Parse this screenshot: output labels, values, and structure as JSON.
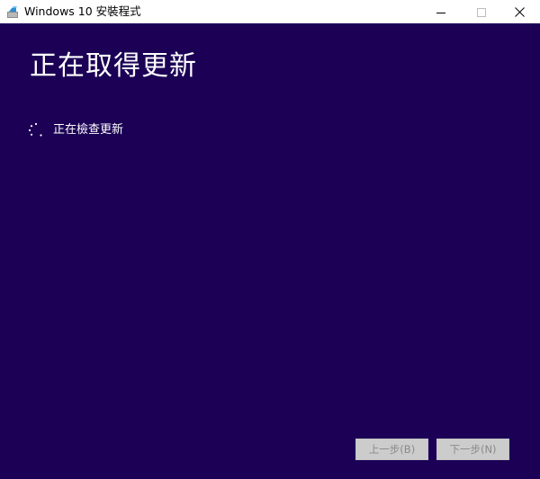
{
  "window": {
    "title": "Windows 10 安裝程式",
    "icons": {
      "app": "setup-app-icon",
      "minimize": "minimize-icon",
      "maximize": "maximize-icon",
      "close": "close-icon"
    }
  },
  "page": {
    "heading": "正在取得更新",
    "status": {
      "icon": "loading-spinner-icon",
      "text": "正在檢查更新"
    }
  },
  "footer": {
    "back_label": "上一步(B)",
    "next_label": "下一步(N)",
    "back_enabled": false,
    "next_enabled": false
  },
  "colors": {
    "background": "#1b0055",
    "titlebar": "#ffffff",
    "text": "#ffffff",
    "button_disabled_bg": "#cccccc",
    "button_disabled_text": "#8a8a8a"
  }
}
